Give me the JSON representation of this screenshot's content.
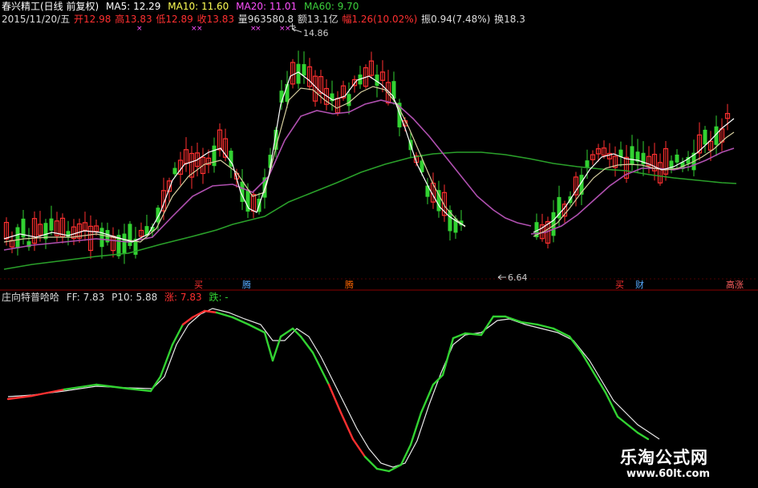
{
  "header": {
    "stock_name": "春兴精工(日线 前复权)",
    "ma5": "MA5: 12.29",
    "ma10": "MA10: 11.60",
    "ma20": "MA20: 11.01",
    "ma60": "MA60: 9.70",
    "date": "2015/11/20/五",
    "open": "开12.98",
    "high": "高13.83",
    "low": "低12.89",
    "close": "收13.83",
    "volume": "量963580.8",
    "amount": "额13.1亿",
    "change": "幅1.26(10.02%)",
    "amplitude": "振0.94(7.48%)",
    "turnover": "换18.3"
  },
  "indicator": {
    "name": "庄向特普哈哈",
    "ff": "FF: 7.83",
    "p10": "P10: 5.88",
    "up": "涨: 7.83",
    "down": "跌: -"
  },
  "price_labels": {
    "high": "14.86",
    "low": "6.64"
  },
  "event_tags": [
    {
      "text": "买",
      "color": "#ff3030"
    },
    {
      "text": "腾",
      "color": "#55aaff"
    },
    {
      "text": "腾",
      "color": "#ff6600"
    },
    {
      "text": "买",
      "color": "#ff3030"
    },
    {
      "text": "财",
      "color": "#55aaff"
    },
    {
      "text": "高涨",
      "color": "#ff6060"
    }
  ],
  "watermark": {
    "title": "乐淘公式网",
    "url": "www.60lt.com"
  },
  "colors": {
    "up": "#ff3030",
    "down": "#32d232",
    "ma5": "#ffffff",
    "ma10": "#d8c840",
    "ma20": "#b050b0",
    "ma60": "#2aa02a",
    "magenta": "#ff50ff",
    "grid": "#800000"
  }
}
